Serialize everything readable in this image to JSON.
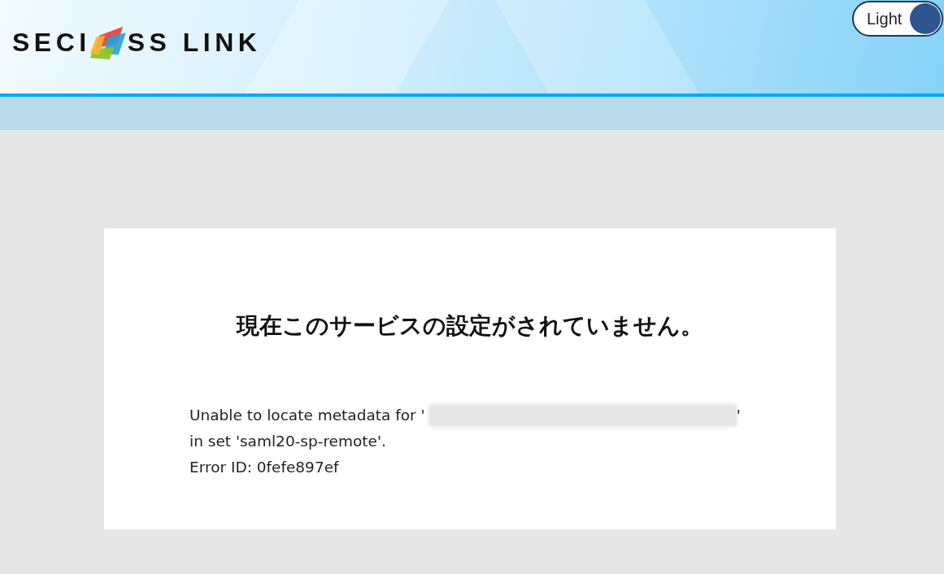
{
  "header": {
    "logo": {
      "text_start": "SECI",
      "text_end": "SS LINK"
    },
    "theme_toggle": {
      "label": "Light",
      "on": true
    }
  },
  "error_card": {
    "title": "現在このサービスの設定がされていません。",
    "message_start": "Unable to locate metadata for '",
    "redacted": true,
    "message_end": "'",
    "set_line": "in set 'saml20-sp-remote'.",
    "error_id": "Error ID: 0fefe897ef"
  }
}
